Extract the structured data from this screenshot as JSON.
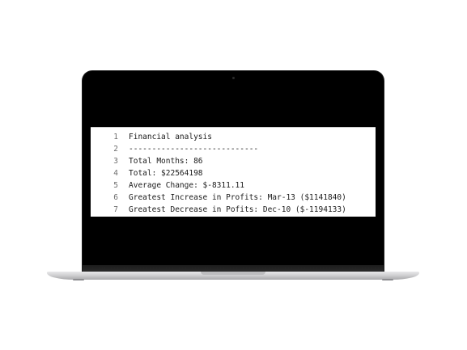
{
  "editor": {
    "lines": [
      {
        "num": "1",
        "text": "Financial analysis"
      },
      {
        "num": "2",
        "text": "----------------------------"
      },
      {
        "num": "3",
        "text": "Total Months: 86"
      },
      {
        "num": "4",
        "text": "Total: $22564198"
      },
      {
        "num": "5",
        "text": "Average Change: $-8311.11"
      },
      {
        "num": "6",
        "text": "Greatest Increase in Profits: Mar-13 ($1141840)"
      },
      {
        "num": "7",
        "text": "Greatest Decrease in Pofits: Dec-10 ($-1194133)"
      }
    ]
  },
  "colors": {
    "bezel": "#000000",
    "editor_bg": "#ffffff",
    "line_number": "#6e6e6e",
    "code_text": "#1a1a1a"
  }
}
